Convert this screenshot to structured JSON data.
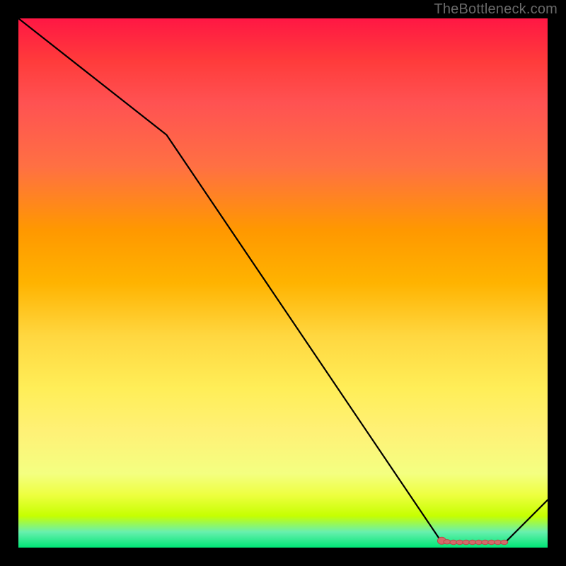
{
  "watermark": "TheBottleneck.com",
  "colors": {
    "background": "#000000",
    "gradient_top": "#ff1744",
    "gradient_bottom": "#00e676",
    "line": "#000000",
    "marker_fill": "#d46a6a",
    "marker_stroke": "#b84a4a"
  },
  "chart_data": {
    "type": "line",
    "title": "",
    "xlabel": "",
    "ylabel": "",
    "xlim": [
      0,
      100
    ],
    "ylim": [
      0,
      100
    ],
    "series": [
      {
        "name": "main-curve",
        "x": [
          0,
          28,
          80,
          92,
          100
        ],
        "y": [
          100,
          78,
          1,
          1,
          9
        ]
      }
    ],
    "markers": {
      "name": "highlight-segment",
      "x": [
        80,
        81,
        82.2,
        83.4,
        84.6,
        85.8,
        87,
        88.2,
        89.4,
        90.6,
        91.8
      ],
      "y": [
        1.3,
        1.1,
        1.0,
        1.0,
        1.0,
        1.0,
        1.0,
        1.0,
        1.0,
        1.0,
        1.0
      ]
    }
  }
}
